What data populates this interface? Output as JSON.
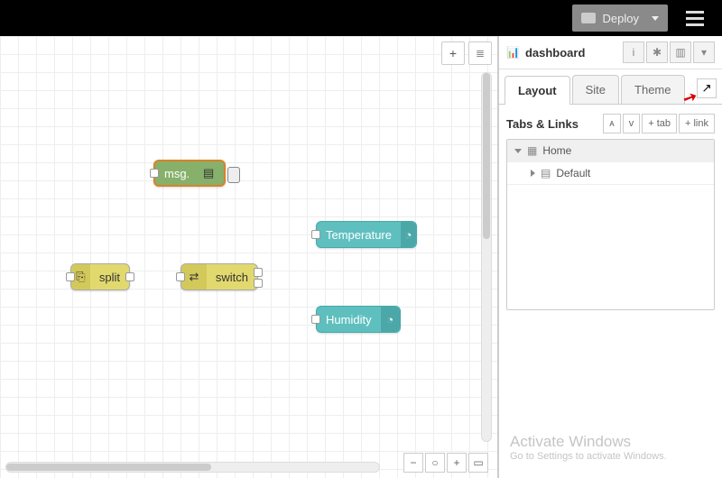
{
  "topbar": {
    "deploy_label": "Deploy"
  },
  "canvas": {
    "nodes": {
      "debug": {
        "label": "msg."
      },
      "split": {
        "label": "split"
      },
      "switch": {
        "label": "switch"
      },
      "temperature": {
        "label": "Temperature"
      },
      "humidity": {
        "label": "Humidity"
      }
    }
  },
  "sidebar": {
    "title": "dashboard",
    "tabs": {
      "layout": "Layout",
      "site": "Site",
      "theme": "Theme"
    },
    "section_title": "Tabs & Links",
    "buttons": {
      "expand": "ᴀ",
      "collapse": "ᴠ",
      "add_tab": "+ tab",
      "add_link": "+ link"
    },
    "tree": {
      "root": "Home",
      "child": "Default"
    }
  },
  "watermark": {
    "title": "Activate Windows",
    "sub": "Go to Settings to activate Windows."
  }
}
